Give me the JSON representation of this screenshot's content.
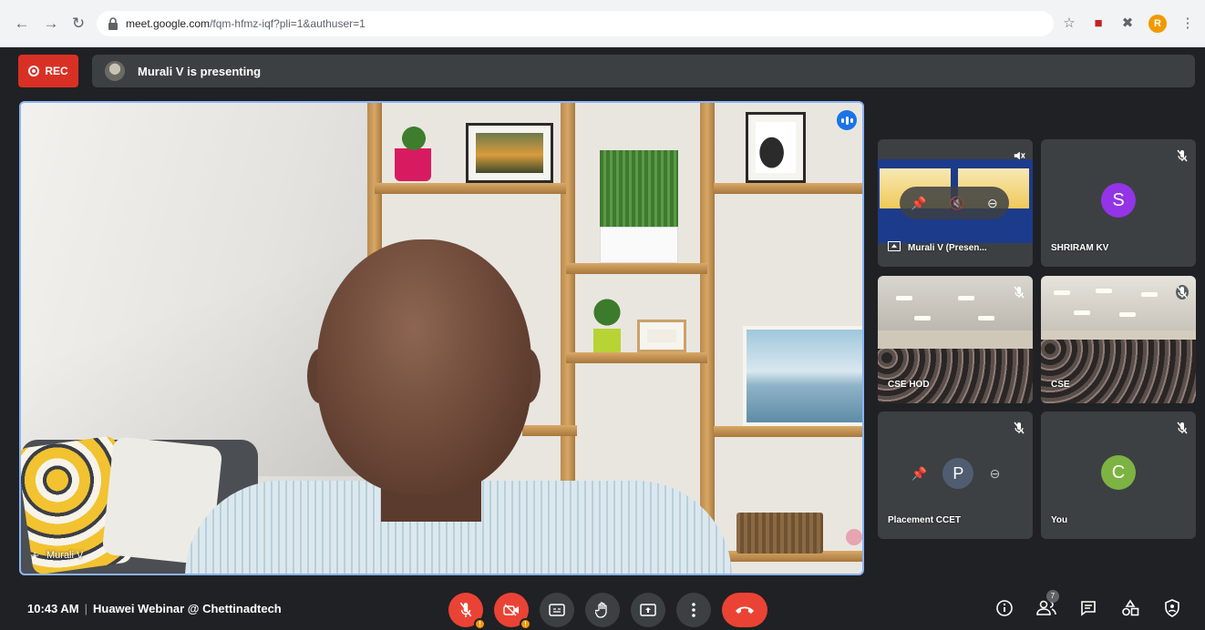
{
  "browser": {
    "url_host": "meet.google.com",
    "url_path": "/fqm-hfmz-iqf?pli=1&authuser=1",
    "profile_initial": "R"
  },
  "rec": {
    "label": "REC"
  },
  "presenting_banner": {
    "text": "Murali V is presenting"
  },
  "main_video": {
    "participant_name": "Murali V"
  },
  "tiles": [
    {
      "name": "Murali V (Presen...",
      "type": "screen-share"
    },
    {
      "name": "SHRIRAM KV",
      "initial": "S",
      "avatar_color": "#9334e6"
    },
    {
      "name": "CSE HOD",
      "type": "video"
    },
    {
      "name": "CSE",
      "type": "video"
    },
    {
      "name": "Placement CCET",
      "initial": "P"
    },
    {
      "name": "You",
      "initial": "C",
      "avatar_color": "#7cb342"
    }
  ],
  "bottom_bar": {
    "time": "10:43 AM",
    "separator": "|",
    "meeting_title": "Huawei Webinar @ Chettinadtech",
    "people_count": "7",
    "mic_warning": "!",
    "cam_warning": "!"
  },
  "colors": {
    "accent_blue": "#1a73e8",
    "end_call_red": "#ea4335",
    "tile_bg": "#3c4043",
    "page_bg": "#202124"
  }
}
